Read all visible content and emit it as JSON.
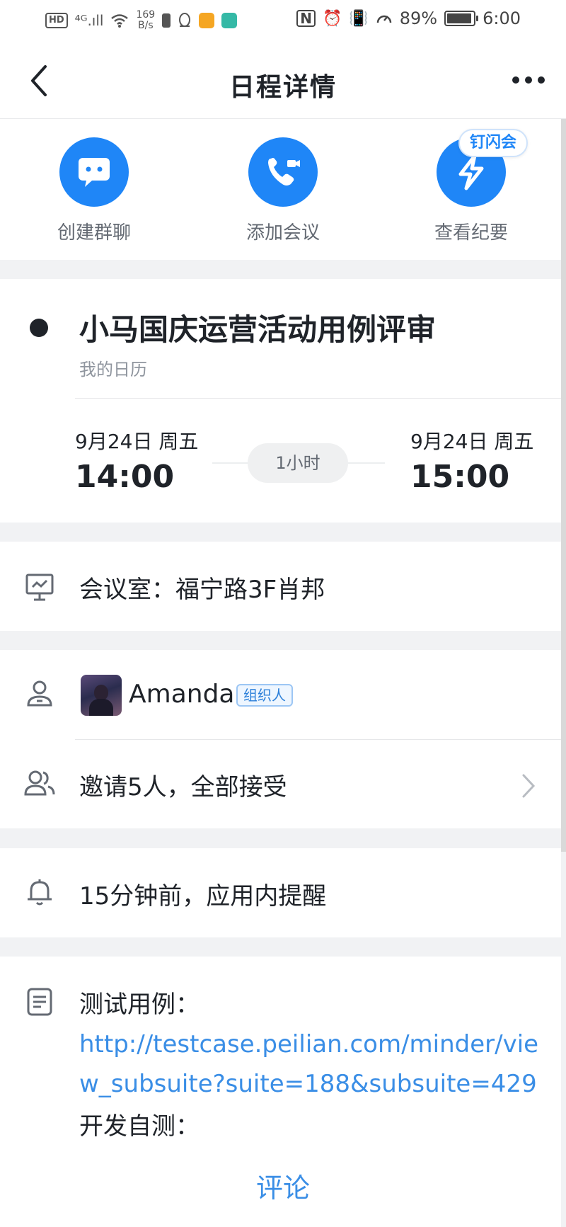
{
  "status_bar": {
    "hd": "HD",
    "signal": "⁴ᴳ.ıll",
    "net_speed_value": "169",
    "net_speed_unit": "B/s",
    "battery": "89%",
    "time": "6:00"
  },
  "nav": {
    "title": "日程详情"
  },
  "actions": [
    {
      "label": "创建群聊",
      "icon": "chat-icon"
    },
    {
      "label": "添加会议",
      "icon": "video-call-icon"
    },
    {
      "label": "查看纪要",
      "icon": "flash-icon"
    }
  ],
  "flash_badge": "钉闪会",
  "event": {
    "title": "小马国庆运营活动用例评审",
    "calendar": "我的日历",
    "start_date": "9月24日 周五",
    "start_time": "14:00",
    "end_date": "9月24日 周五",
    "end_time": "15:00",
    "duration": "1小时"
  },
  "room": {
    "text": "会议室：福宁路3F肖邦"
  },
  "organizer": {
    "name": "Amanda",
    "tag": "组织人"
  },
  "invitees": {
    "text": "邀请5人，全部接受"
  },
  "reminder": {
    "text": "15分钟前，应用内提醒"
  },
  "description": {
    "line1": "测试用例：",
    "link": "http://testcase.peilian.com/minder/view_subsuite?suite=188&subsuite=429",
    "line3": "开发自测："
  },
  "comment_label": "评论",
  "colors": {
    "accent": "#1f86f7",
    "link": "#3a8ee6",
    "background": "#f1f2f4"
  }
}
